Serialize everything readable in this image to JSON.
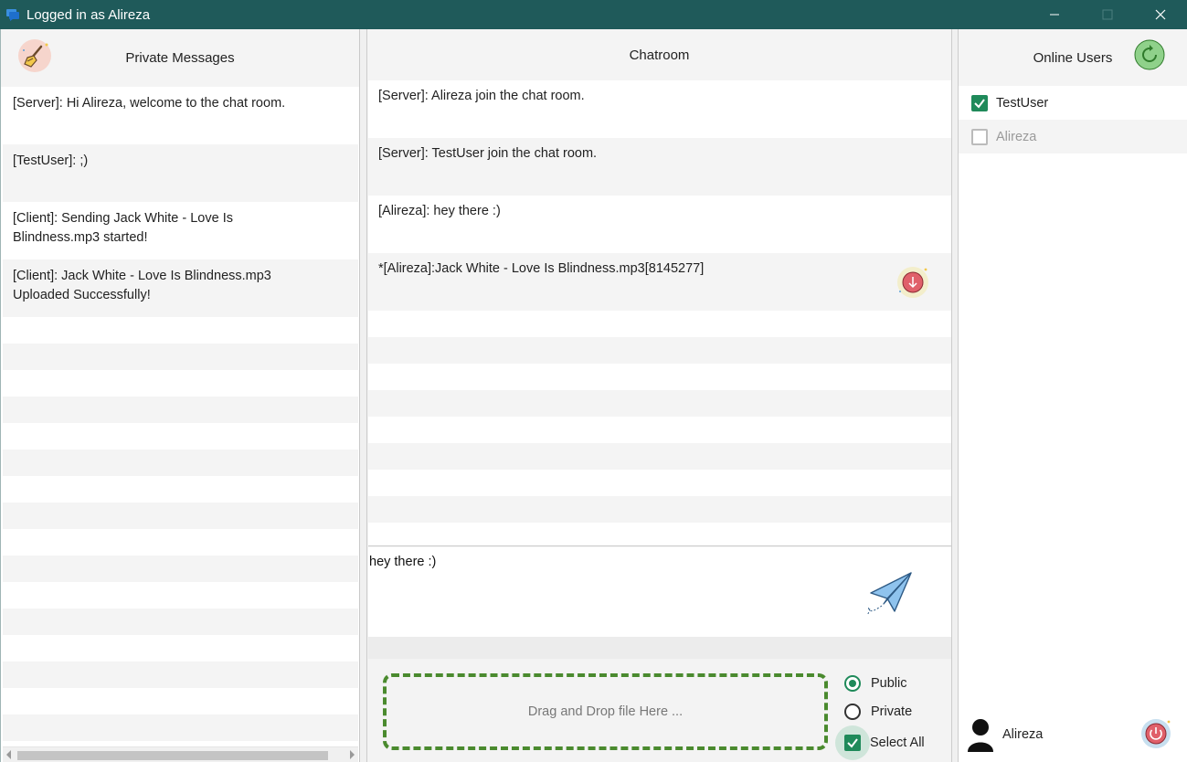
{
  "window": {
    "title": "Logged in as Alireza",
    "controls": {
      "minimize": "—",
      "maximize": "☐",
      "close": "✕"
    }
  },
  "private_messages": {
    "header": "Private Messages",
    "clear_icon": "broom-icon",
    "messages": [
      "[Server]: Hi Alireza, welcome to the chat room.",
      "[TestUser]: ;)",
      "[Client]: Sending Jack White - Love Is Blindness.mp3 started!",
      "[Client]: Jack White - Love Is Blindness.mp3 Uploaded Successfully!"
    ]
  },
  "chatroom": {
    "header": "Chatroom",
    "messages": [
      "[Server]: Alireza join the chat room.",
      "[Server]: TestUser join the chat room.",
      "[Alireza]: hey there :)",
      "*[Alireza]:Jack White - Love Is Blindness.mp3[8145277]"
    ],
    "download_icon": "download-icon",
    "compose_value": "hey there :)",
    "send_icon": "paper-plane-icon",
    "drop_zone_text": "Drag and Drop file Here ...",
    "visibility_options": [
      {
        "label": "Public",
        "checked": true
      },
      {
        "label": "Private",
        "checked": false
      }
    ],
    "select_all_label": "Select All",
    "select_all_checked": true
  },
  "online_users": {
    "header": "Online Users",
    "refresh_icon": "refresh-icon",
    "users": [
      {
        "name": "TestUser",
        "checked": true
      },
      {
        "name": "Alireza",
        "checked": false
      }
    ],
    "current_user": "Alireza",
    "logout_icon": "power-icon"
  },
  "colors": {
    "titlebar": "#1f5a5a",
    "accent_green": "#1f8a5a",
    "dropzone_border": "#4a8a2e"
  }
}
